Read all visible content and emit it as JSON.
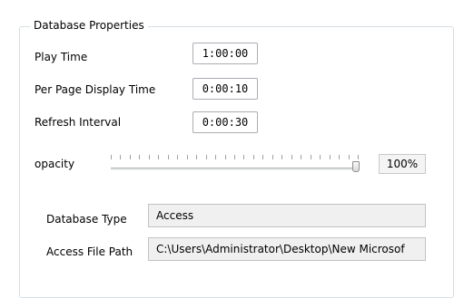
{
  "group": {
    "title": "Database Properties"
  },
  "fields": {
    "play_time": {
      "label": "Play Time",
      "value": "1:00:00"
    },
    "per_page_time": {
      "label": "Per Page Display Time",
      "value": "0:00:10"
    },
    "refresh_interval": {
      "label": "Refresh Interval",
      "value": "0:00:30"
    }
  },
  "opacity": {
    "label": "opacity",
    "value_text": "100%",
    "level": 1.0
  },
  "database_type": {
    "label": "Database Type",
    "value": "Access"
  },
  "access_file_path": {
    "label": "Access File Path",
    "value": "C:\\Users\\Administrator\\Desktop\\New Microsof"
  }
}
